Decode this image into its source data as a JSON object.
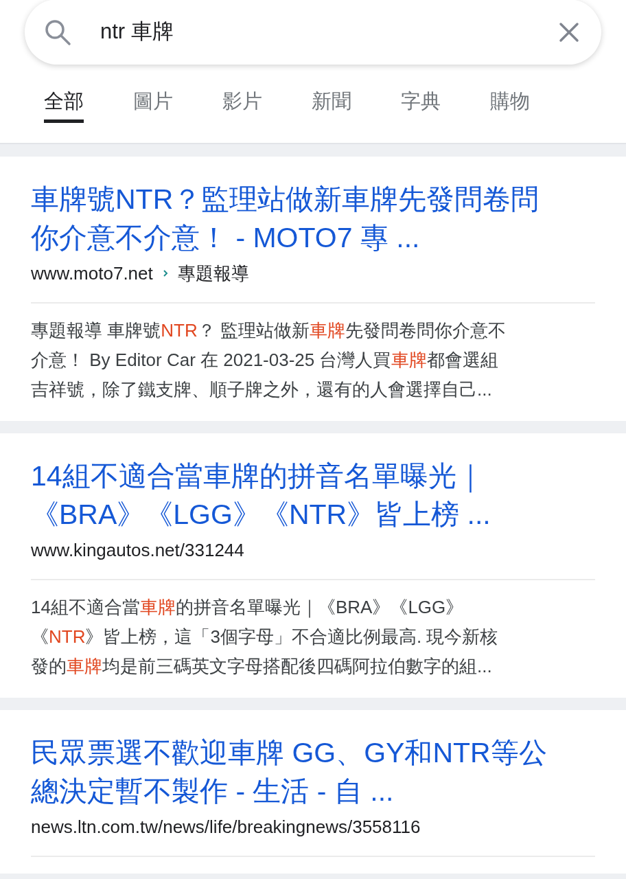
{
  "search": {
    "value": "ntr 車牌"
  },
  "tabs": [
    {
      "label": "全部",
      "selected": true
    },
    {
      "label": "圖片",
      "selected": false
    },
    {
      "label": "影片",
      "selected": false
    },
    {
      "label": "新聞",
      "selected": false
    },
    {
      "label": "字典",
      "selected": false
    },
    {
      "label": "購物",
      "selected": false
    }
  ],
  "results": [
    {
      "title_lines": [
        "車牌號NTR？監理站做新車牌先發問卷問",
        "你介意不介意！ - MOTO7 專 ..."
      ],
      "url": "www.moto7.net",
      "breadcrumb": "專題報導",
      "snippet_lines": [
        [
          {
            "text": "專題報導 車牌號",
            "highlight": false
          },
          {
            "text": "NTR",
            "highlight": true
          },
          {
            "text": "？ 監理站做新",
            "highlight": false
          },
          {
            "text": "車牌",
            "highlight": true
          },
          {
            "text": "先發問卷問你介意不",
            "highlight": false
          }
        ],
        [
          {
            "text": "介意！ By Editor Car 在 2021-03-25 台灣人買",
            "highlight": false
          },
          {
            "text": "車牌",
            "highlight": true
          },
          {
            "text": "都會選組",
            "highlight": false
          }
        ],
        [
          {
            "text": "吉祥號，除了鐵支牌、順子牌之外，還有的人會選擇自己...",
            "highlight": false
          }
        ]
      ]
    },
    {
      "title_lines": [
        "14組不適合當車牌的拼音名單曝光｜",
        "《BRA》《LGG》《NTR》皆上榜 ..."
      ],
      "url": "www.kingautos.net/331244",
      "snippet_lines": [
        [
          {
            "text": "14組不適合當",
            "highlight": false
          },
          {
            "text": "車牌",
            "highlight": true
          },
          {
            "text": "的拼音名單曝光｜《BRA》《LGG》",
            "highlight": false
          }
        ],
        [
          {
            "text": "《",
            "highlight": false
          },
          {
            "text": "NTR",
            "highlight": true
          },
          {
            "text": "》皆上榜，這「3個字母」不合適比例最高. 現今新核",
            "highlight": false
          }
        ],
        [
          {
            "text": "發的",
            "highlight": false
          },
          {
            "text": "車牌",
            "highlight": true
          },
          {
            "text": "均是前三碼英文字母搭配後四碼阿拉伯數字的組...",
            "highlight": false
          }
        ]
      ]
    },
    {
      "title_lines": [
        "民眾票選不歡迎車牌 GG、GY和NTR等公",
        "總決定暫不製作 - 生活 - 自 ..."
      ],
      "url": "news.ltn.com.tw/news/life/breakingnews/3558116"
    }
  ]
}
